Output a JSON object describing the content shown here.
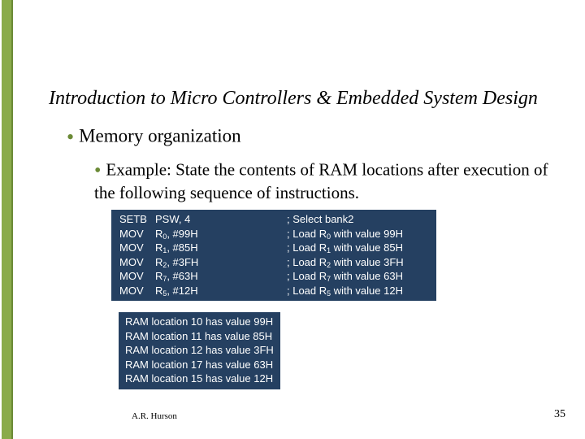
{
  "title": "Introduction to Micro Controllers & Embedded System Design",
  "bullet_level1": "Memory organization",
  "bullet_level2": "Example:  State the contents of RAM locations after execution of the following sequence of instructions.",
  "code": {
    "rows": [
      {
        "mnemonic": "SETB",
        "operands": "PSW, 4",
        "reg_sub": "",
        "comment_prefix": "; Select bank2",
        "comment_reg_sub": "",
        "comment_tail": ""
      },
      {
        "mnemonic": "MOV",
        "operands": "R0, #99H",
        "reg_sub": "0",
        "comment_prefix": "; Load R",
        "comment_reg_sub": "0",
        "comment_tail": " with value 99H"
      },
      {
        "mnemonic": "MOV",
        "operands": "R1, #85H",
        "reg_sub": "1",
        "comment_prefix": "; Load R",
        "comment_reg_sub": "1",
        "comment_tail": " with value 85H"
      },
      {
        "mnemonic": "MOV",
        "operands": "R2, #3FH",
        "reg_sub": "2",
        "comment_prefix": "; Load R",
        "comment_reg_sub": "2",
        "comment_tail": " with value 3FH"
      },
      {
        "mnemonic": "MOV",
        "operands": "R7, #63H",
        "reg_sub": "7",
        "comment_prefix": "; Load R",
        "comment_reg_sub": "7",
        "comment_tail": " with value 63H"
      },
      {
        "mnemonic": "MOV",
        "operands": "R5, #12H",
        "reg_sub": "5",
        "comment_prefix": "; Load R",
        "comment_reg_sub": "5",
        "comment_tail": " with value 12H"
      }
    ]
  },
  "result_lines": [
    "RAM location 10 has value 99H",
    "RAM location 11 has value 85H",
    "RAM location 12 has value 3FH",
    "RAM location 17 has value 63H",
    "RAM location 15 has value 12H"
  ],
  "footer_author": "A.R. Hurson",
  "page_number": "35"
}
